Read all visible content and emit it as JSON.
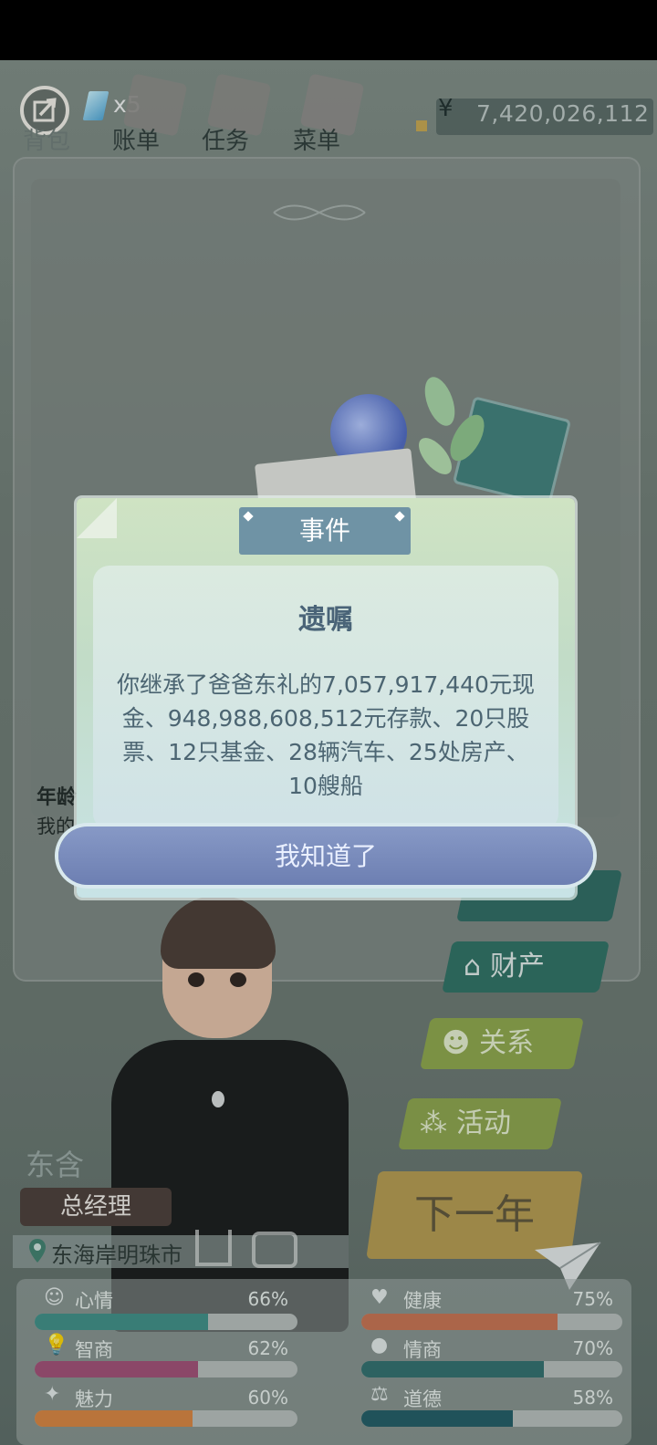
{
  "nav": {
    "diamond_count": "x5",
    "tabs": [
      {
        "label": "背包"
      },
      {
        "label": "账单"
      },
      {
        "label": "任务"
      },
      {
        "label": "菜单"
      }
    ],
    "currency_symbol": "¥",
    "money": "7,420,026,112"
  },
  "dialog": {
    "tag": "事件",
    "title": "遗嘱",
    "body": "你继承了爸爸东礼的7,057,917,440元现金、948,988,608,512元存款、20只股票、12只基金、28辆汽车、25处房产、10艘船",
    "confirm": "我知道了"
  },
  "panel": {
    "age_label": "年龄",
    "desc": "我的"
  },
  "side_menu": [
    {
      "label": "财产"
    },
    {
      "label": "关系"
    },
    {
      "label": "活动"
    }
  ],
  "next_year": "下一年",
  "character": {
    "name": "东含",
    "title": "总经理",
    "location": "东海岸明珠市"
  },
  "stats": {
    "mood": {
      "label": "心情",
      "value": "66%",
      "fraction": 0.66,
      "color": "#3e8e86"
    },
    "iq": {
      "label": "智商",
      "value": "62%",
      "fraction": 0.62,
      "color": "#a24c74"
    },
    "charm": {
      "label": "魅力",
      "value": "60%",
      "fraction": 0.6,
      "color": "#d9833e"
    },
    "health": {
      "label": "健康",
      "value": "75%",
      "fraction": 0.75,
      "color": "#c9714f"
    },
    "eq": {
      "label": "情商",
      "value": "70%",
      "fraction": 0.7,
      "color": "#2f6d6c"
    },
    "morality": {
      "label": "道德",
      "value": "58%",
      "fraction": 0.58,
      "color": "#1f5a63"
    }
  }
}
